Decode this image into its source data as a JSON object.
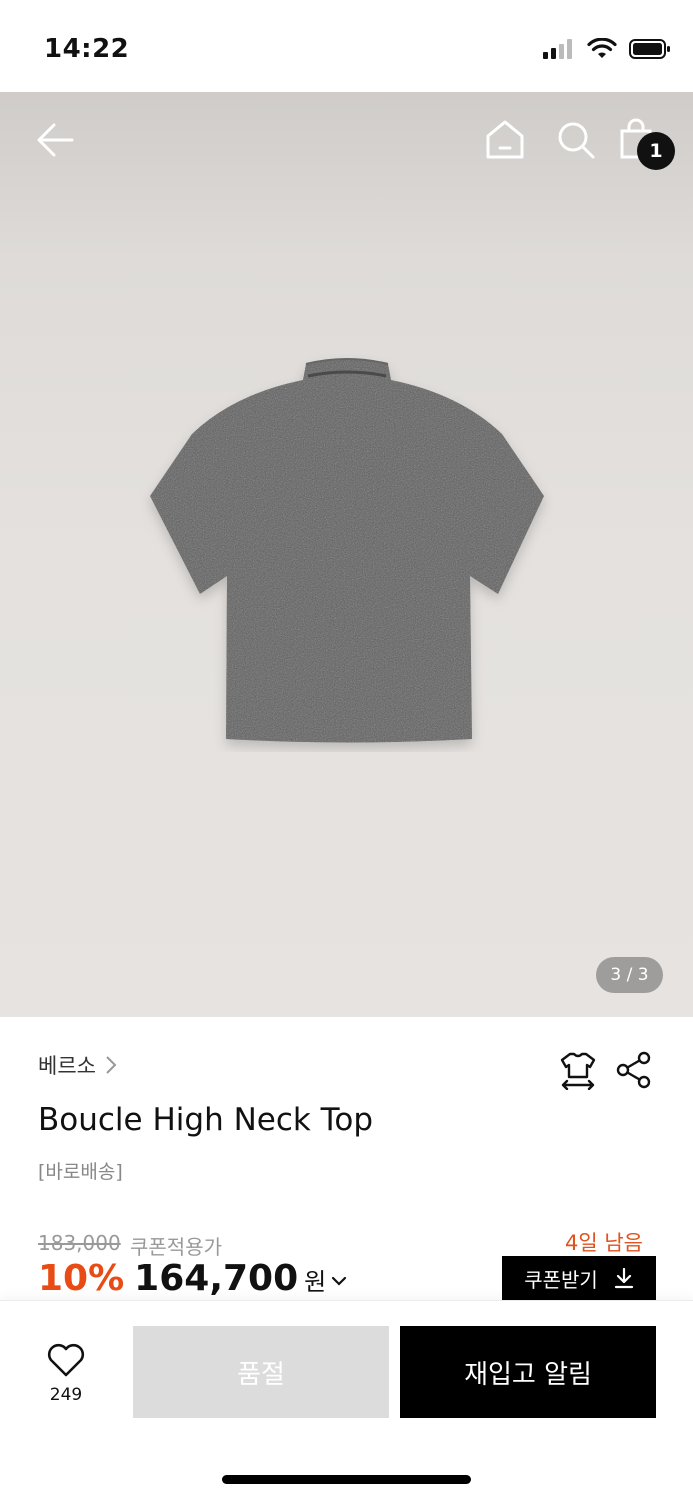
{
  "status_bar": {
    "time": "14:22"
  },
  "header": {
    "cart_count": "1"
  },
  "gallery": {
    "page_indicator": "3 / 3",
    "image_colors": {
      "top": "#cfccca",
      "background": "#e4e1de",
      "garment": "#5a5a5a"
    }
  },
  "product": {
    "brand": "베르소",
    "name": "Boucle High Neck Top",
    "delivery_tag": "[바로배송]"
  },
  "pricing": {
    "original_price": "183,000",
    "coupon_label": "쿠폰적용가",
    "days_left": "4일 남음",
    "discount_rate": "10%",
    "sale_price": "164,700",
    "currency": "원",
    "coupon_button": "쿠폰받기"
  },
  "actions": {
    "like_count": "249",
    "soldout_label": "품절",
    "restock_label": "재입고 알림"
  },
  "colors": {
    "accent_orange": "#e84c14",
    "black": "#000000",
    "disabled_gray": "#dcdcdc"
  }
}
